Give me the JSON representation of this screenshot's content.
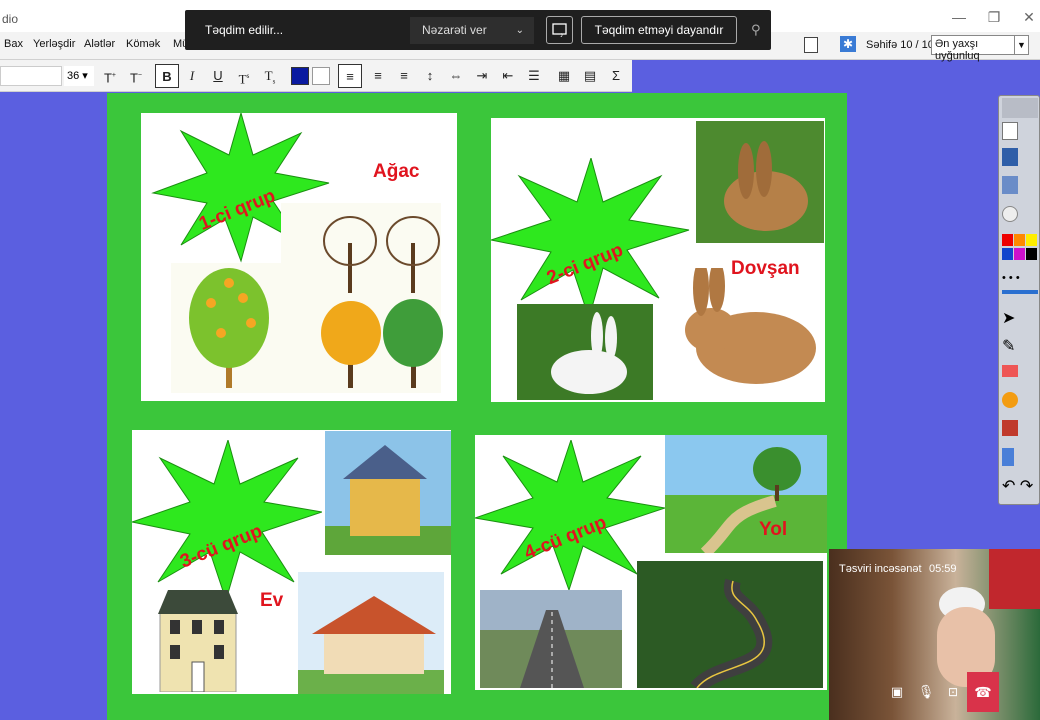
{
  "window": {
    "title": "dio",
    "min": "—",
    "max": "❐",
    "close": "✕"
  },
  "menu": {
    "items": [
      "Bax",
      "Yerləşdir",
      "Alətlər",
      "Kömək",
      "Mü"
    ],
    "page_info": "Səhifə 10 / 10",
    "zoom": "Ən yaxşı uyğunluq"
  },
  "format": {
    "font_size": "36",
    "bold": "B",
    "italic": "I",
    "underline": "U",
    "superscript": "T",
    "subscript": "T",
    "grow": "T",
    "shrink": "T",
    "sigma": "Σ"
  },
  "presenting": {
    "status": "Təqdim edilir...",
    "control": "Nəzarəti ver",
    "stop": "Təqdim etməyi dayandır"
  },
  "slide": {
    "groups": [
      {
        "label": "1-ci qrup",
        "word": "Ağac"
      },
      {
        "label": "2-ci qrup",
        "word": "Dovşan"
      },
      {
        "label": "3-cü qrup",
        "word": "Ev"
      },
      {
        "label": "4-cü qrup",
        "word": "Yol"
      }
    ]
  },
  "call": {
    "name": "Təsviri incəsənət",
    "time": "05:59"
  },
  "colors": {
    "slide_bg": "#3bc63b",
    "desktop_bg": "#5b5fe0",
    "burst": "#2ee81e",
    "label": "#e0141e",
    "end_call": "#d9334a"
  }
}
